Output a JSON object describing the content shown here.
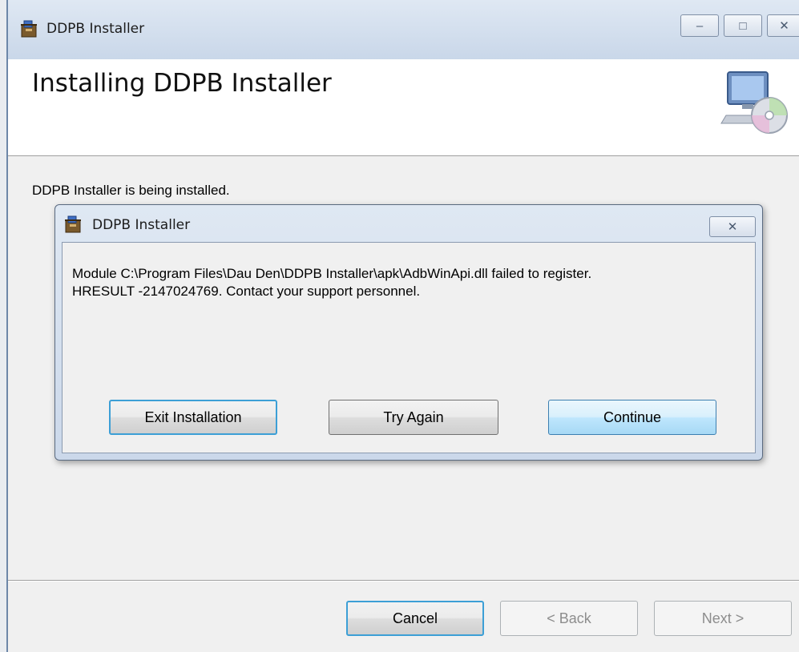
{
  "window": {
    "title": "DDPB Installer",
    "minimize_glyph": "‒",
    "maximize_glyph": "□",
    "close_glyph": "✕"
  },
  "header": {
    "title": "Installing DDPB Installer"
  },
  "status_text": "DDPB Installer is being installed.",
  "dialog": {
    "title": "DDPB Installer",
    "close_glyph": "✕",
    "message": "Module C:\\Program Files\\Dau Den\\DDPB Installer\\apk\\AdbWinApi.dll failed to register.\nHRESULT -2147024769.  Contact your support personnel.",
    "buttons": {
      "exit": "Exit Installation",
      "retry": "Try Again",
      "continue": "Continue"
    }
  },
  "footer": {
    "cancel": "Cancel",
    "back": "< Back",
    "next": "Next >"
  },
  "icons": {
    "app": "installer-box-icon",
    "header": "computer-cd-icon"
  },
  "colors": {
    "default_button_border": "#3c9fd6",
    "titlebar": "#c9d7e9"
  }
}
